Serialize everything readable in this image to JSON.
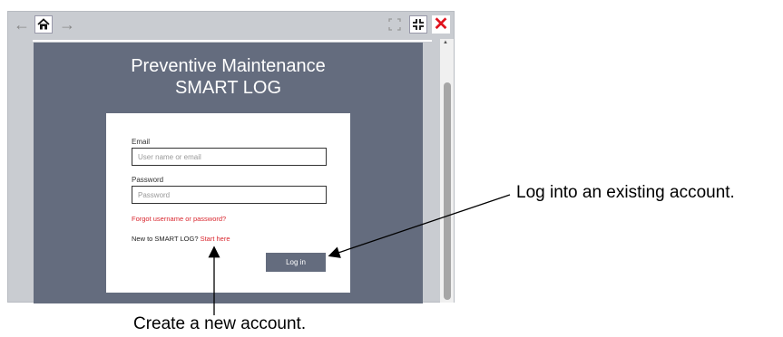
{
  "toolbar": {
    "back_icon": "arrow-left-icon",
    "home_icon": "home-icon",
    "forward_icon": "arrow-right-icon",
    "fullscreen_icon": "fullscreen-icon",
    "shrink_icon": "shrink-icon",
    "close_icon": "close-icon"
  },
  "app": {
    "title_line1": "Preventive Maintenance",
    "title_line2": "SMART LOG"
  },
  "login_form": {
    "email_label": "Email",
    "email_placeholder": "User name or email",
    "password_label": "Password",
    "password_placeholder": "Password",
    "forgot_link": "Forgot username or password?",
    "new_prompt": "New to SMART LOG?",
    "start_link": "Start here",
    "login_button": "Log in"
  },
  "annotations": {
    "login_note": "Log into an existing account.",
    "create_note": "Create a new account."
  },
  "colors": {
    "panel_bg": "#646c7e",
    "link_red": "#d9262e",
    "close_red": "#e0121d"
  }
}
